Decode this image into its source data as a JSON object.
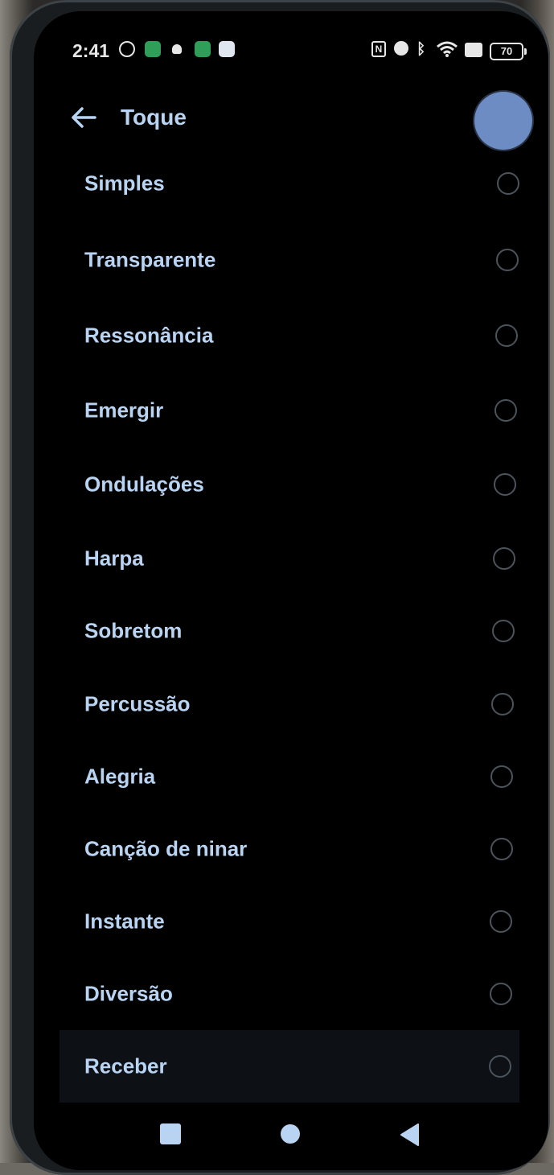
{
  "status_bar": {
    "time": "2:41",
    "battery": "70",
    "nfc_icon": "nfc-icon",
    "alarm_icon": "alarm-icon",
    "bluetooth_icon": "bluetooth-icon",
    "wifi_icon": "wifi-icon",
    "sim_icon": "no-sim-icon"
  },
  "header": {
    "title": "Toque",
    "back_icon": "back-arrow-icon"
  },
  "options": [
    {
      "label": "Simples"
    },
    {
      "label": "Transparente"
    },
    {
      "label": "Ressonância"
    },
    {
      "label": "Emergir"
    },
    {
      "label": "Ondulações"
    },
    {
      "label": "Harpa"
    },
    {
      "label": "Sobretom"
    },
    {
      "label": "Percussão"
    },
    {
      "label": "Alegria"
    },
    {
      "label": "Canção de ninar"
    },
    {
      "label": "Instante"
    },
    {
      "label": "Diversão"
    },
    {
      "label": "Receber"
    }
  ],
  "colors": {
    "accent": "#b9d4f2",
    "background": "#000000",
    "radio_border": "#4b535b"
  }
}
